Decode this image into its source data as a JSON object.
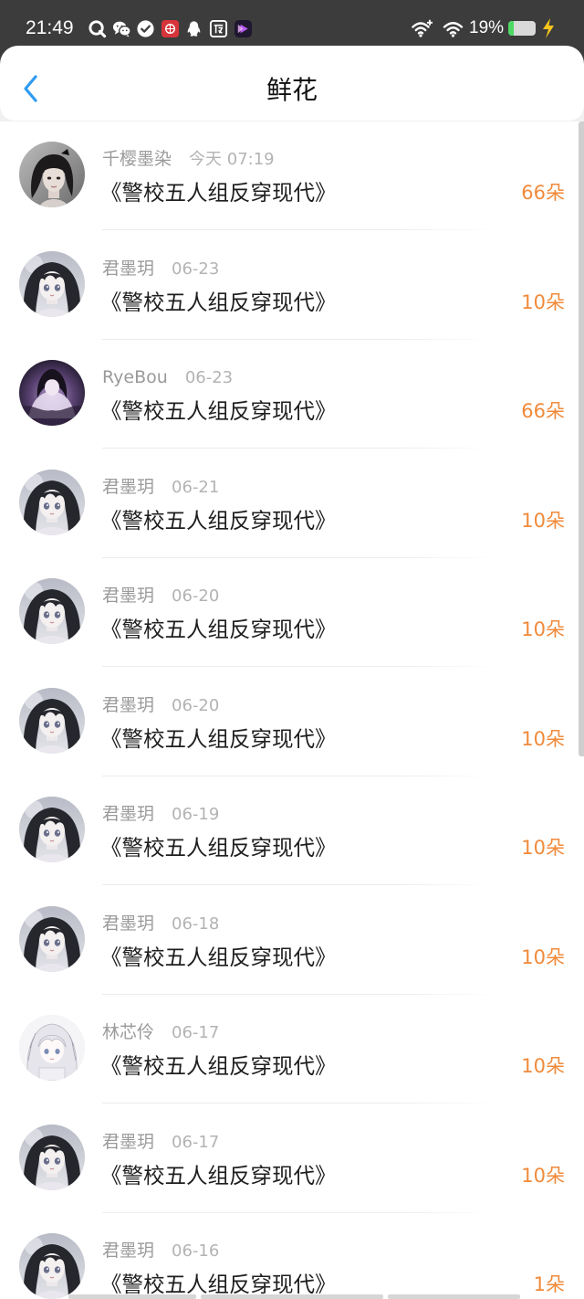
{
  "theme": {
    "accent": "#2f9bf0",
    "flower_count": "#f08a3b",
    "user_name": "#9a9a9a",
    "date": "#b3b3b3",
    "book_title": "#1e1e1e",
    "status_bar": "#3c3c3c"
  },
  "status_bar": {
    "time": "21:49",
    "notification_icons": [
      "qq-browser-icon",
      "wechat-icon",
      "check-circle-icon",
      "red-app-icon",
      "qq-icon",
      "baidu-icon",
      "video-app-icon"
    ],
    "system_icons": [
      "hotspot-icon",
      "wifi-icon",
      "battery-icon",
      "charging-bolt-icon"
    ],
    "battery_text": "19%",
    "battery_level": 0.19
  },
  "header": {
    "back_icon": "chevron-left-icon",
    "title": "鲜花"
  },
  "records": [
    {
      "avatar": "avatar-photo-girl-icon",
      "user": "千樱墨染",
      "date": "今天 07:19",
      "book": "《警校五人组反穿现代》",
      "count": "66朵"
    },
    {
      "avatar": "avatar-anime-dark-hair-icon",
      "user": "君墨玥",
      "date": "06-23",
      "book": "《警校五人组反穿现代》",
      "count": "10朵"
    },
    {
      "avatar": "avatar-anime-purple-icon",
      "user": "RyeBou",
      "date": "06-23",
      "book": "《警校五人组反穿现代》",
      "count": "66朵"
    },
    {
      "avatar": "avatar-anime-dark-hair-icon",
      "user": "君墨玥",
      "date": "06-21",
      "book": "《警校五人组反穿现代》",
      "count": "10朵"
    },
    {
      "avatar": "avatar-anime-dark-hair-icon",
      "user": "君墨玥",
      "date": "06-20",
      "book": "《警校五人组反穿现代》",
      "count": "10朵"
    },
    {
      "avatar": "avatar-anime-dark-hair-icon",
      "user": "君墨玥",
      "date": "06-20",
      "book": "《警校五人组反穿现代》",
      "count": "10朵"
    },
    {
      "avatar": "avatar-anime-dark-hair-icon",
      "user": "君墨玥",
      "date": "06-19",
      "book": "《警校五人组反穿现代》",
      "count": "10朵"
    },
    {
      "avatar": "avatar-anime-dark-hair-icon",
      "user": "君墨玥",
      "date": "06-18",
      "book": "《警校五人组反穿现代》",
      "count": "10朵"
    },
    {
      "avatar": "avatar-anime-white-hair-icon",
      "user": "林芯伶",
      "date": "06-17",
      "book": "《警校五人组反穿现代》",
      "count": "10朵"
    },
    {
      "avatar": "avatar-anime-dark-hair-icon",
      "user": "君墨玥",
      "date": "06-17",
      "book": "《警校五人组反穿现代》",
      "count": "10朵"
    },
    {
      "avatar": "avatar-anime-dark-hair-icon",
      "user": "君墨玥",
      "date": "06-16",
      "book": "《警校五人组反穿现代》",
      "count": "1朵"
    }
  ]
}
